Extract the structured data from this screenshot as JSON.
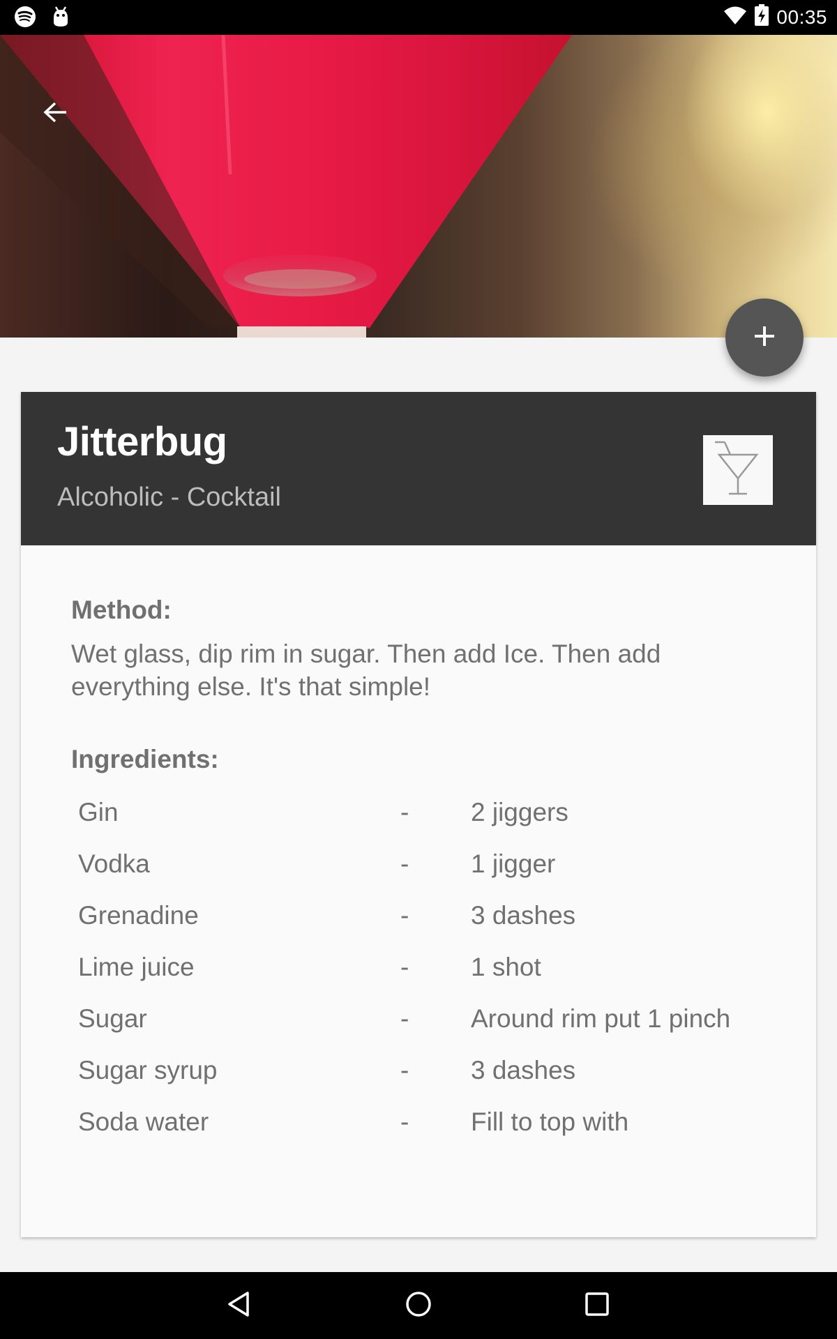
{
  "status_bar": {
    "time": "00:35",
    "left_icons": [
      "spotify-icon",
      "android-debug-icon"
    ],
    "right_icons": [
      "wifi-icon",
      "battery-charging-icon"
    ]
  },
  "toolbar": {
    "back_icon": "arrow-back-icon"
  },
  "fab": {
    "icon": "plus-icon"
  },
  "drink": {
    "name": "Jitterbug",
    "subtitle": "Alcoholic - Cocktail",
    "glass_icon": "cocktail-glass-icon"
  },
  "method": {
    "heading": "Method:",
    "text": "Wet glass, dip rim in sugar. Then add Ice. Then add everything else. It's that simple!"
  },
  "ingredients": {
    "heading": "Ingredients:",
    "items": [
      {
        "name": "Gin",
        "separator": "-",
        "measure": "2 jiggers"
      },
      {
        "name": "Vodka",
        "separator": "-",
        "measure": "1 jigger"
      },
      {
        "name": "Grenadine",
        "separator": "-",
        "measure": "3 dashes"
      },
      {
        "name": "Lime juice",
        "separator": "-",
        "measure": "1 shot"
      },
      {
        "name": "Sugar",
        "separator": "-",
        "measure": "Around rim put 1 pinch"
      },
      {
        "name": "Sugar syrup",
        "separator": "-",
        "measure": "3 dashes"
      },
      {
        "name": "Soda water",
        "separator": "-",
        "measure": "Fill to top with"
      }
    ]
  },
  "nav_bar": {
    "buttons": [
      "back-triangle-icon",
      "home-circle-icon",
      "recents-square-icon"
    ]
  },
  "colors": {
    "header_bg": "#343434",
    "fab_bg": "#555555",
    "text_gray": "#707070",
    "drink_red": "#e0163f"
  }
}
